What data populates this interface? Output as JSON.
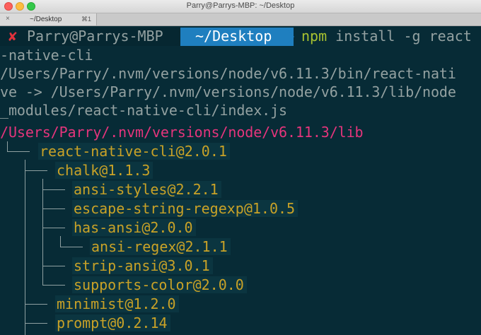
{
  "window": {
    "title": "Parry@Parrys-MBP: ~/Desktop"
  },
  "tab": {
    "close": "×",
    "label": "~/Desktop",
    "shortcut": "⌘1"
  },
  "prompt": {
    "status_icon": "x-mark-icon",
    "user_host": "Parry@Parrys-MBP",
    "directory": "~/Desktop",
    "command_name": "npm",
    "command_args": " install -g react"
  },
  "output": {
    "wrap1": "-native-cli",
    "link1": "/Users/Parry/.nvm/versions/node/v6.11.3/bin/react-nati",
    "link2": "ve -> /Users/Parry/.nvm/versions/node/v6.11.3/lib/node",
    "link3": "_modules/react-native-cli/index.js",
    "prefix": "/Users/Parry/.nvm/versions/node/v6.11.3/lib"
  },
  "tree": {
    "root": "react-native-cli@2.0.1",
    "chalk": "chalk@1.1.3",
    "ansi_styles": "ansi-styles@2.2.1",
    "escape_string_regexp": "escape-string-regexp@1.0.5",
    "has_ansi": "has-ansi@2.0.0",
    "ansi_regex": "ansi-regex@2.1.1",
    "strip_ansi": "strip-ansi@3.0.1",
    "supports_color": "supports-color@2.0.0",
    "minimist": "minimist@1.2.0",
    "prompt": "prompt@0.2.14"
  },
  "colors": {
    "background": "#072b36",
    "prompt_dir_bg": "#1f7fbf",
    "error_red": "#e0323c",
    "path_pink": "#e5357c",
    "npm_green": "#a8c230",
    "package_yellow": "#c9a227"
  }
}
